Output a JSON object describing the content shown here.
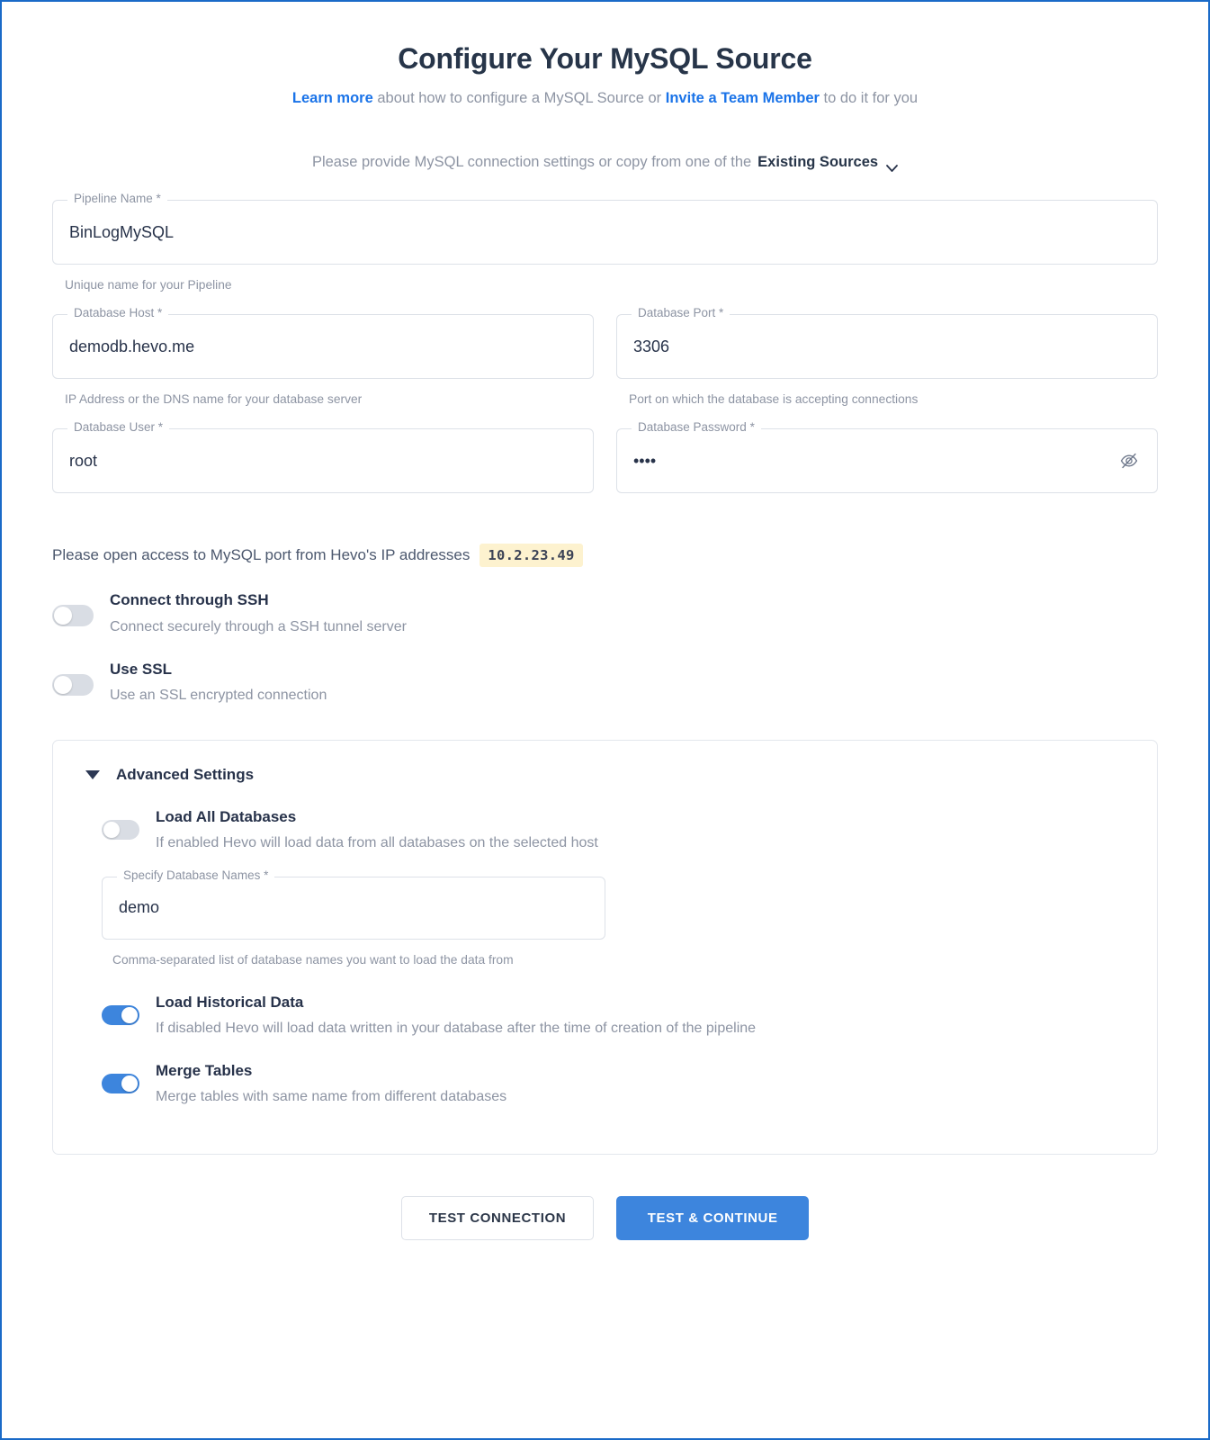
{
  "header": {
    "title": "Configure Your MySQL Source",
    "subtitle_link_1": "Learn more",
    "subtitle_mid": " about how to configure a MySQL Source or ",
    "subtitle_link_2": "Invite a Team Member",
    "subtitle_end": " to do it for you",
    "source_prompt": "Please provide MySQL connection settings or copy from one of the",
    "existing_sources_label": "Existing Sources",
    "chevron_icon": "chevron-down-icon"
  },
  "fields": {
    "pipeline_name": {
      "label": "Pipeline Name *",
      "value": "BinLogMySQL",
      "helper": "Unique name for your Pipeline"
    },
    "database_host": {
      "label": "Database Host *",
      "value": "demodb.hevo.me",
      "helper": "IP Address or the DNS name for your database server"
    },
    "database_port": {
      "label": "Database Port *",
      "value": "3306",
      "helper": "Port on which the database is accepting connections"
    },
    "database_user": {
      "label": "Database User *",
      "value": "root"
    },
    "database_password": {
      "label": "Database Password *",
      "value": "••••",
      "reveal_icon": "eye-off-icon"
    }
  },
  "ip_notice": {
    "text": "Please open access to MySQL port from Hevo's IP addresses",
    "ip": "10.2.23.49"
  },
  "toggles": [
    {
      "name": "connect-through-ssh",
      "label": "Connect through SSH",
      "description": "Connect securely through a SSH tunnel server",
      "state": "off"
    },
    {
      "name": "use-ssl",
      "label": "Use SSL",
      "description": "Use an SSL encrypted connection",
      "state": "off"
    }
  ],
  "advanced": {
    "title": "Advanced Settings",
    "expanded": true,
    "collapse_icon": "triangle-down-icon",
    "load_all_databases": {
      "label": "Load All Databases",
      "description": "If enabled Hevo will load data from all databases on the selected host",
      "state": "off"
    },
    "specify_database_names": {
      "label": "Specify Database Names *",
      "value": "demo",
      "helper": "Comma-separated list of database names you want to load the data from"
    },
    "load_historical_data": {
      "label": "Load Historical Data",
      "description": "If disabled Hevo will load data written in your database after the time of creation of the pipeline",
      "state": "on"
    },
    "merge_tables": {
      "label": "Merge Tables",
      "description": "Merge tables with same name from different databases",
      "state": "on"
    }
  },
  "footer": {
    "test_connection": "TEST CONNECTION",
    "test_and_continue": "TEST & CONTINUE"
  },
  "colors": {
    "accent_blue": "#3d85dd",
    "link_blue": "#1a73e8",
    "title_navy": "#273549",
    "muted_text": "#8d94a3",
    "ip_chip_bg": "#fdf2cf",
    "frame_border": "#1a6ac8"
  }
}
